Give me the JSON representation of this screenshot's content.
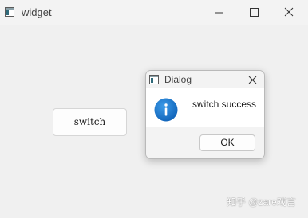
{
  "main_window": {
    "title": "widget",
    "app_icon": "window-app-icon",
    "controls": {
      "minimize_icon": "minimize-icon",
      "maximize_icon": "maximize-icon",
      "close_icon": "close-icon"
    }
  },
  "content": {
    "switch_button_label": "switch"
  },
  "dialog": {
    "title": "Dialog",
    "app_icon": "window-app-icon",
    "close_icon": "close-icon",
    "message_icon": "information-icon",
    "message": "switch success",
    "ok_label": "OK"
  },
  "watermark": {
    "text": "知乎 @zare戏言"
  },
  "colors": {
    "background": "#f0f0f0",
    "dialog_body": "#ffffff",
    "info_icon_blue": "#1578d1",
    "app_icon_teal": "#2f6a7a"
  }
}
